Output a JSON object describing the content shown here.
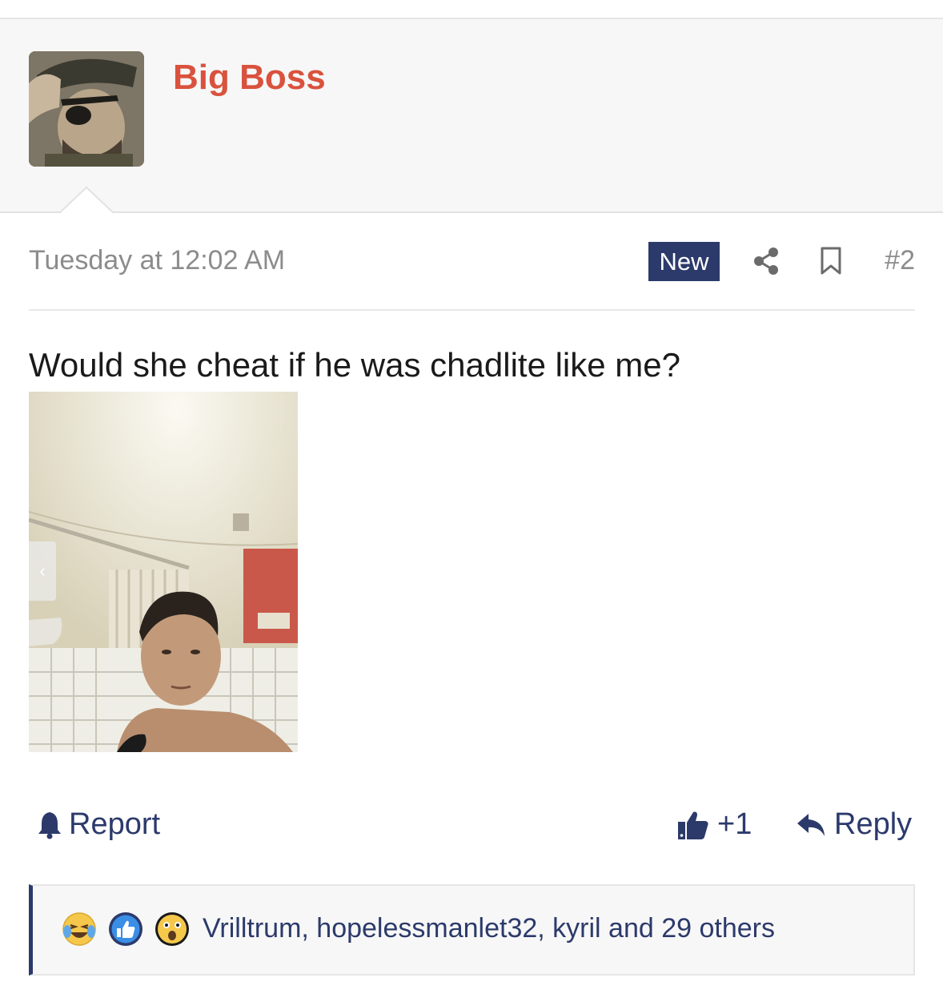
{
  "user": {
    "name": "Big Boss",
    "name_color": "#d9523d"
  },
  "post": {
    "timestamp": "Tuesday at 12:02 AM",
    "new_badge": "New",
    "post_number": "#2",
    "text": "Would she cheat if he was chadlite like me?",
    "gallery_prev_glyph": "‹"
  },
  "actions": {
    "report_label": "Report",
    "like_count": "+1",
    "reply_label": "Reply"
  },
  "reactions": {
    "icons": [
      "laughing-crying-icon",
      "like-icon",
      "wow-icon"
    ],
    "summary": "Vrilltrum, hopelessmanlet32, kyril and 29 others"
  },
  "colors": {
    "accent": "#2c3a6b",
    "username": "#d9523d",
    "meta_text": "#8c8c8c"
  }
}
